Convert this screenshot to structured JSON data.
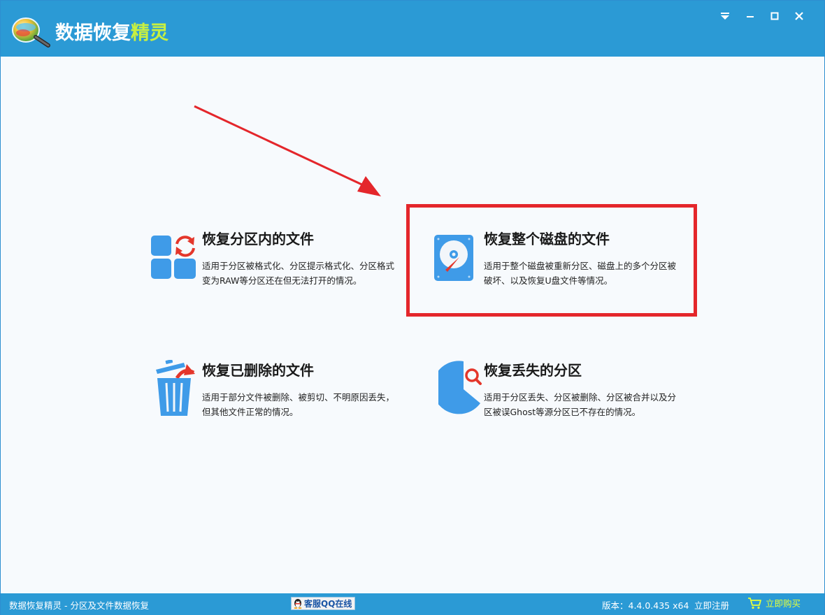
{
  "app": {
    "title_main": "数据恢复",
    "title_accent": "精灵"
  },
  "window_controls": {
    "menu_icon": "dropdown-menu-icon",
    "minimize_icon": "minimize-icon",
    "maximize_icon": "maximize-icon",
    "close_icon": "close-icon"
  },
  "cards": [
    {
      "title": "恢复分区内的文件",
      "desc": "适用于分区被格式化、分区提示格式化、分区格式变为RAW等分区还在但无法打开的情况。",
      "icon": "partition-recover-icon"
    },
    {
      "title": "恢复整个磁盘的文件",
      "desc": "适用于整个磁盘被重新分区、磁盘上的多个分区被破坏、以及恢复U盘文件等情况。",
      "icon": "hard-disk-icon"
    },
    {
      "title": "恢复已删除的文件",
      "desc": "适用于部分文件被删除、被剪切、不明原因丢失，但其他文件正常的情况。",
      "icon": "recycle-bin-icon"
    },
    {
      "title": "恢复丢失的分区",
      "desc": "适用于分区丢失、分区被删除、分区被合并以及分区被误Ghost等源分区已不存在的情况。",
      "icon": "lost-partition-icon"
    }
  ],
  "colors": {
    "titlebar": "#2b9ad5",
    "accent_text": "#c8f040",
    "highlight": "#e4262b",
    "icon_blue": "#3f9be8"
  },
  "status": {
    "left_text": "数据恢复精灵 - 分区及文件数据恢复",
    "qq_label": "客服QQ在线",
    "version": "版本：4.4.0.435 x64",
    "register": "立即注册",
    "buy": "立即购买"
  }
}
